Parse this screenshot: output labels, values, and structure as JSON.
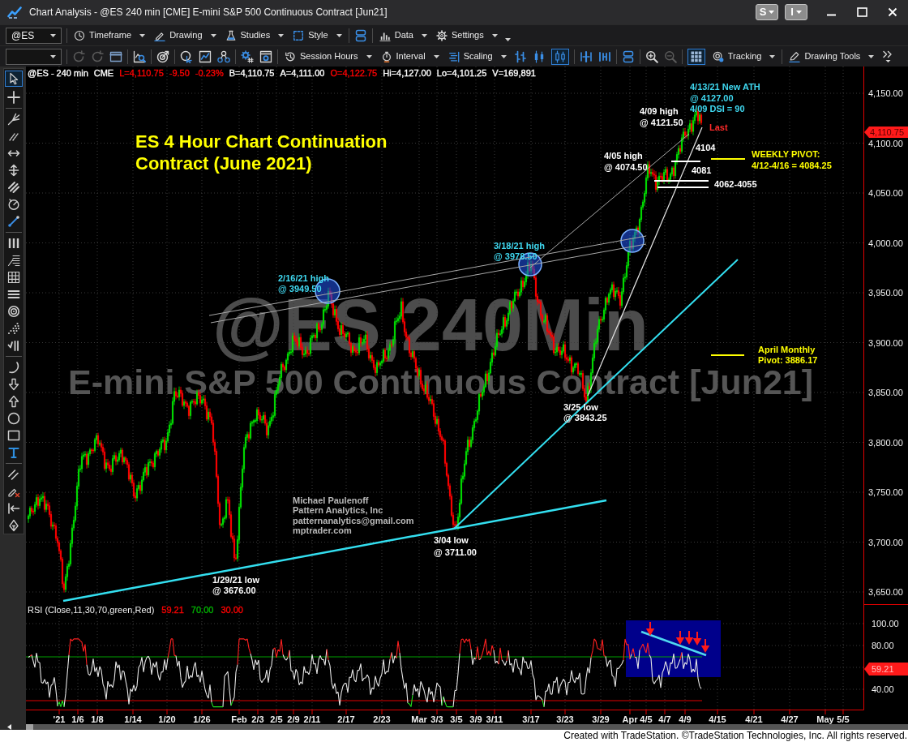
{
  "window": {
    "title": "Chart Analysis - @ES 240 min [CME] E-mini S&P 500 Continuous Contract [Jun21]",
    "menus": [
      {
        "label": "S"
      },
      {
        "label": "I"
      }
    ]
  },
  "toolbar_1": {
    "groups": [
      [
        {
          "kind": "symbol",
          "value": "@ES"
        }
      ],
      [
        {
          "kind": "timeframe",
          "label": "Timeframe"
        },
        {
          "kind": "drawing",
          "label": "Drawing"
        },
        {
          "kind": "studies",
          "label": "Studies"
        },
        {
          "kind": "style",
          "label": "Style"
        }
      ],
      [
        {
          "kind": "layout"
        }
      ],
      [
        {
          "kind": "data",
          "label": "Data"
        },
        {
          "kind": "settings",
          "label": "Settings"
        },
        {
          "kind": "more"
        }
      ]
    ]
  },
  "toolbar_2": {
    "groups": [
      [
        {
          "kind": "symbol"
        }
      ],
      [
        {
          "kind": "refresh",
          "disabled": true
        },
        {
          "kind": "refresh",
          "disabled": true
        },
        {
          "kind": "window",
          "disabled": false
        }
      ],
      [
        {
          "kind": "chart_search"
        }
      ],
      [
        {
          "kind": "target"
        }
      ],
      [
        {
          "kind": "pointer_circle"
        },
        {
          "kind": "chart_save"
        },
        {
          "kind": "network"
        }
      ],
      [
        {
          "kind": "gear_hash"
        },
        {
          "kind": "window_gear"
        }
      ],
      [
        {
          "kind": "session",
          "label": "Session Hours"
        },
        {
          "kind": "interval",
          "label": "Interval"
        },
        {
          "kind": "scaling",
          "label": "Scaling"
        },
        {
          "kind": "bar_style",
          "selected": false
        },
        {
          "kind": "candle_style",
          "selected": false
        },
        {
          "kind": "hollow_style",
          "selected": true
        }
      ],
      [
        {
          "kind": "bars_in"
        },
        {
          "kind": "bars_out"
        }
      ],
      [
        {
          "kind": "layout"
        }
      ],
      [
        {
          "kind": "zoom_in",
          "disabled": false
        },
        {
          "kind": "zoom_out",
          "disabled": true
        }
      ],
      [
        {
          "kind": "grid",
          "on": true
        },
        {
          "kind": "tracking",
          "label": "Tracking"
        }
      ],
      [
        {
          "kind": "drawing_tools",
          "label": "Drawing Tools"
        },
        {
          "kind": "overflow"
        }
      ]
    ]
  },
  "drawing_tools": {
    "groups": [
      [
        {
          "kind": "pointer",
          "selected": true
        },
        {
          "kind": "crosshair",
          "selected": false
        }
      ],
      [
        {
          "kind": "pitchfork",
          "selected": false
        },
        {
          "kind": "parallel",
          "selected": false
        },
        {
          "kind": "h_arrow",
          "selected": false
        },
        {
          "kind": "v_arrow",
          "selected": false
        },
        {
          "kind": "channel",
          "selected": false
        },
        {
          "kind": "gauge",
          "selected": false
        },
        {
          "kind": "trendline",
          "selected": false
        }
      ],
      [
        {
          "kind": "v_lines",
          "selected": false
        },
        {
          "kind": "fib",
          "selected": false
        },
        {
          "kind": "grid",
          "selected": false
        },
        {
          "kind": "h_lines",
          "selected": false
        },
        {
          "kind": "rings",
          "selected": false
        },
        {
          "kind": "dots",
          "selected": false
        },
        {
          "kind": "tick",
          "selected": false
        }
      ],
      [
        {
          "kind": "arc",
          "selected": false
        },
        {
          "kind": "down_arrow",
          "selected": false
        },
        {
          "kind": "up_arrow",
          "selected": false
        },
        {
          "kind": "ellipse",
          "selected": false
        },
        {
          "kind": "rectangle",
          "selected": false
        },
        {
          "kind": "text",
          "selected": false
        }
      ],
      [
        {
          "kind": "double_line",
          "selected": false
        },
        {
          "kind": "eraser",
          "selected": false
        },
        {
          "kind": "arrow_bar",
          "selected": false
        },
        {
          "kind": "pen",
          "selected": false
        }
      ]
    ]
  },
  "chart": {
    "quote": [
      {
        "text": "@ES - 240 min",
        "color": "#ffffff"
      },
      {
        "text": "CME",
        "color": "#ffffff"
      },
      {
        "text": "L=4,110.75",
        "color": "#ff0000"
      },
      {
        "text": "-9.50",
        "color": "#ff0000"
      },
      {
        "text": "-0.23%",
        "color": "#ff0000"
      },
      {
        "text": "B=4,110.75",
        "color": "#ffffff"
      },
      {
        "text": "A=4,111.00",
        "color": "#ffffff"
      },
      {
        "text": "O=4,122.75",
        "color": "#ff0000"
      },
      {
        "text": "Hi=4,127.00",
        "color": "#ffffff"
      },
      {
        "text": "Lo=4,101.25",
        "color": "#ffffff"
      },
      {
        "text": "V=169,891",
        "color": "#ffffff"
      }
    ],
    "symbol_watermark": "@ES,240Min",
    "contract_watermark": "E-mini S&P 500 Continuous Contract [Jun21]",
    "annotations": [
      {
        "kind": "title",
        "color": "#ffff00",
        "lines": [
          "ES 4 Hour Chart Continuation",
          "Contract (June 2021)"
        ]
      },
      {
        "kind": "note",
        "color": "#3fd8f0",
        "lines": [
          "4/13/21 New ATH",
          "@ 4127.00",
          "4/09 DSI = 90"
        ]
      },
      {
        "kind": "note",
        "color": "#ffffff",
        "lines": [
          "4/09 high",
          "@ 4121.50"
        ]
      },
      {
        "kind": "note",
        "color": "#ff2a2a",
        "lines": [
          "Last"
        ]
      },
      {
        "kind": "note",
        "color": "#ffffff",
        "lines": [
          "4/05 high",
          "@ 4074.50"
        ]
      },
      {
        "kind": "note",
        "color": "#ffffff",
        "lines": [
          "4104"
        ]
      },
      {
        "kind": "note",
        "color": "#ffff00",
        "lines": [
          "WEEKLY PIVOT:",
          "4/12-4/16 = 4084.25"
        ]
      },
      {
        "kind": "note",
        "color": "#ffffff",
        "lines": [
          "4081"
        ]
      },
      {
        "kind": "note",
        "color": "#ffffff",
        "lines": [
          "4062-4055"
        ]
      },
      {
        "kind": "note",
        "color": "#3fd8f0",
        "lines": [
          "3/18/21 high",
          "@ 3978.50"
        ]
      },
      {
        "kind": "note",
        "color": "#3fd8f0",
        "lines": [
          "2/16/21 high",
          "@ 3949.50"
        ]
      },
      {
        "kind": "note",
        "color": "#ffff00",
        "lines": [
          "April Monthly",
          "Pivot: 3886.17"
        ]
      },
      {
        "kind": "note",
        "color": "#ffffff",
        "lines": [
          "3/25 low",
          "@ 3843.25"
        ]
      },
      {
        "kind": "credit",
        "color": "#b8b8b8",
        "lines": [
          "Michael Paulenoff",
          "Pattern Analytics, Inc",
          "patternanalytics@gmail.com",
          "mptrader.com"
        ]
      },
      {
        "kind": "note",
        "color": "#ffffff",
        "lines": [
          "3/04 low",
          "@ 3711.00"
        ]
      },
      {
        "kind": "note",
        "color": "#ffffff",
        "lines": [
          "1/29/21 low",
          "@ 3676.00"
        ]
      }
    ],
    "price_axis": [
      "4,150.00",
      "4,100.00",
      "4,050.00",
      "4,000.00",
      "3,950.00",
      "3,900.00",
      "3,850.00",
      "3,800.00",
      "3,750.00",
      "3,700.00",
      "3,650.00"
    ],
    "last_price": "4,110.75",
    "rsi": {
      "label": "RSI (Close,11,30,70,green,Red)",
      "readings": [
        {
          "text": "59.21",
          "color": "#ff0000"
        },
        {
          "text": "70.00",
          "color": "#00b000"
        },
        {
          "text": "30.00",
          "color": "#ff0000"
        }
      ],
      "axis": [
        "100.00",
        "80.00",
        "40.00"
      ],
      "last_value": "59.21"
    },
    "time_axis": [
      "'21",
      "1/6",
      "1/8",
      "1/14",
      "1/20",
      "1/26",
      "Feb",
      "2/3",
      "2/5",
      "2/9",
      "2/11",
      "2/17",
      "2/23",
      "Mar",
      "3/3",
      "3/5",
      "3/9",
      "3/11",
      "3/17",
      "3/23",
      "3/29",
      "Apr",
      "4/5",
      "4/7",
      "4/9",
      "4/15",
      "4/21",
      "4/27",
      "May",
      "5/5"
    ]
  },
  "footer": "Created with TradeStation. ©TradeStation Technologies, Inc. All rights reserved."
}
